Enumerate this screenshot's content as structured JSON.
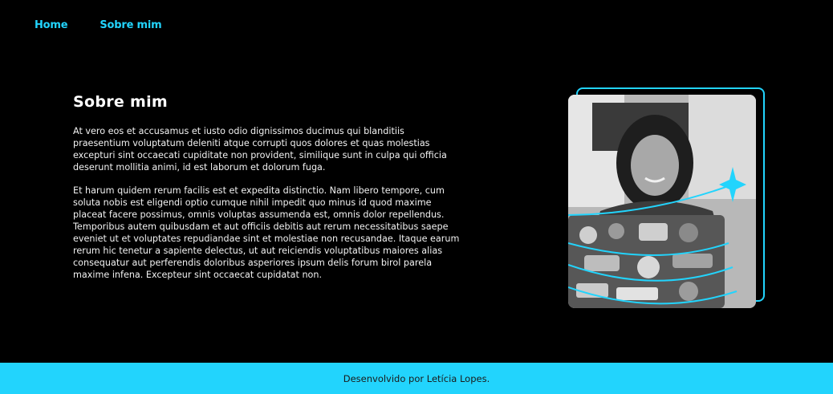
{
  "nav": {
    "items": [
      {
        "label": "Home"
      },
      {
        "label": "Sobre mim"
      }
    ]
  },
  "about": {
    "title": "Sobre mim",
    "paragraphs": [
      "At vero eos et accusamus et iusto odio dignissimos ducimus qui blanditiis praesentium voluptatum deleniti atque corrupti quos dolores et quas molestias excepturi sint occaecati cupiditate non provident, similique sunt in culpa qui officia deserunt mollitia animi, id est laborum et dolorum fuga.",
      "Et harum quidem rerum facilis est et expedita distinctio. Nam libero tempore, cum soluta nobis est eligendi optio cumque nihil impedit quo minus id quod maxime placeat facere possimus, omnis voluptas assumenda est, omnis dolor repellendus. Temporibus autem quibusdam et aut officiis debitis aut rerum necessitatibus saepe eveniet ut et voluptates repudiandae sint et molestiae non recusandae. Itaque earum rerum hic tenetur a sapiente delectus, ut aut reiciendis voluptatibus maiores alias consequatur aut perferendis doloribus asperiores ipsum delis forum birol parela maxime infena. Excepteur sint occaecat cupidatat non."
    ]
  },
  "footer": {
    "text": "Desenvolvido por Letícia Lopes."
  },
  "colors": {
    "accent": "#22d4fd",
    "background": "#000000",
    "footer_text": "#1a1a1a"
  }
}
